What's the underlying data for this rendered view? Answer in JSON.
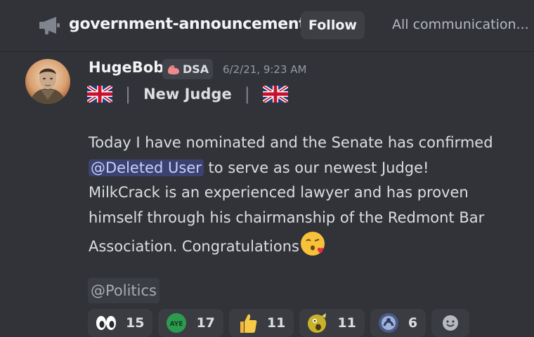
{
  "header": {
    "channel_icon": "megaphone-icon",
    "channel_name": "government-announcements",
    "follow_label": "Follow",
    "description": "All communication..."
  },
  "message": {
    "username": "HugeBob",
    "tag": {
      "icon": "muscle-icon",
      "label": "DSA"
    },
    "timestamp": "6/2/21, 9:23 AM",
    "headline": {
      "flag_icon": "uk-flag-icon",
      "separator": "|",
      "title": "New Judge"
    },
    "body_before": "Today I have nominated and the Senate has confirmed ",
    "mention": "@Deleted User",
    "body_after": " to serve as our newest Judge! MilkCrack is an experienced lawyer and has proven himself through his chairmanship of the Redmont Bar Association. Congratulations",
    "body_emoji": "kissing-face-icon",
    "role_mention": "@Politics"
  },
  "reactions": [
    {
      "icon": "eyes-icon",
      "count": "15"
    },
    {
      "icon": "aye-icon",
      "count": "17"
    },
    {
      "icon": "thumbs-up-icon",
      "count": "11"
    },
    {
      "icon": "shocked-face-icon",
      "count": "11"
    },
    {
      "icon": "badge-icon",
      "count": "6"
    }
  ],
  "add_reaction_icon": "add-reaction-icon",
  "colors": {
    "background": "#313338",
    "mention_bg": "#3c4270",
    "mention_fg": "#c9cdfb",
    "aye_green": "#2d9b4f"
  }
}
